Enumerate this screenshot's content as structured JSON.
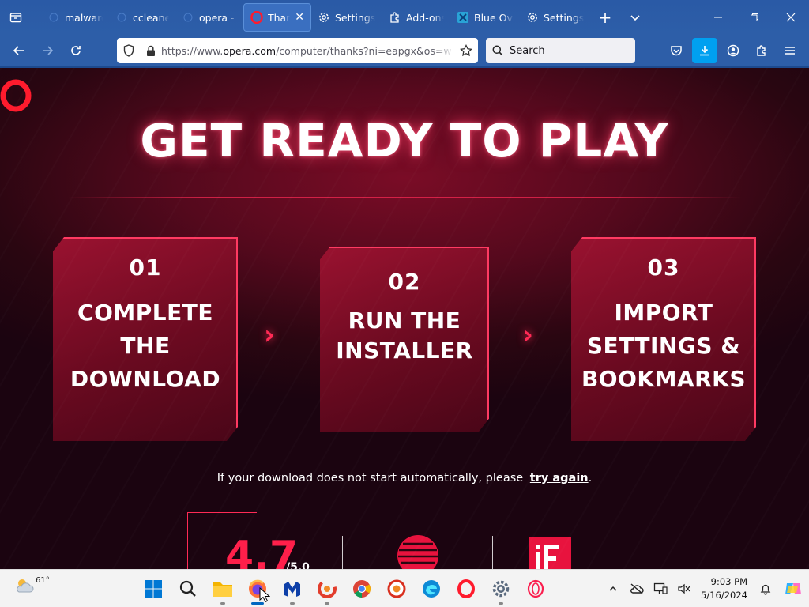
{
  "tabs": [
    {
      "title": "malware",
      "icon": "blank-page-icon",
      "active": false
    },
    {
      "title": "ccleaner",
      "icon": "blank-page-icon",
      "active": false
    },
    {
      "title": "opera - Bing",
      "icon": "blank-page-icon",
      "active": false
    },
    {
      "title": "Thank",
      "icon": "opera-icon",
      "active": true
    },
    {
      "title": "Settings",
      "icon": "gear-icon",
      "active": false
    },
    {
      "title": "Add-ons",
      "icon": "puzzle-icon",
      "active": false
    },
    {
      "title": "Blue Oval",
      "icon": "blue-app-icon",
      "active": false
    },
    {
      "title": "Settings",
      "icon": "gear-icon",
      "active": false
    }
  ],
  "navbar": {
    "url_prefix": "https://www.",
    "url_domain": "opera.com",
    "url_path": "/computer/thanks?ni=eapgx&os=w",
    "search_placeholder": "Search"
  },
  "page": {
    "headline": "GET READY TO PLAY",
    "steps": [
      {
        "num": "01",
        "lines": [
          "COMPLETE",
          "THE",
          "DOWNLOAD"
        ]
      },
      {
        "num": "02",
        "lines": [
          "RUN THE",
          "INSTALLER"
        ]
      },
      {
        "num": "03",
        "lines": [
          "IMPORT",
          "SETTINGS &",
          "BOOKMARKS"
        ]
      }
    ],
    "retry_text": "If your download does not start automatically, please",
    "retry_link": "try again",
    "retry_suffix": ".",
    "rating": "4.7",
    "rating_of": "/5.0"
  },
  "taskbar": {
    "weather_temp": "61°",
    "time": "9:03 PM",
    "date": "5/16/2024"
  },
  "colors": {
    "accent": "#ff2a55",
    "browser_blue": "#2d5ea8"
  }
}
